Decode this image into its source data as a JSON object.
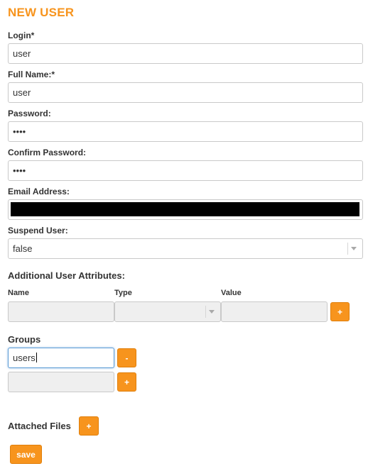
{
  "form": {
    "title": "NEW USER",
    "login": {
      "label": "Login*",
      "value": "user"
    },
    "full_name": {
      "label": "Full Name:*",
      "value": "user"
    },
    "password": {
      "label": "Password:",
      "value": "••••"
    },
    "confirm_password": {
      "label": "Confirm Password:",
      "value": "••••"
    },
    "email": {
      "label": "Email Address:",
      "value": ""
    },
    "suspend": {
      "label": "Suspend User:",
      "value": "false"
    },
    "attributes": {
      "label": "Additional User Attributes:",
      "col_name": "Name",
      "col_type": "Type",
      "col_value": "Value",
      "row": {
        "name": "",
        "type": "",
        "value": ""
      },
      "add_label": "+"
    },
    "groups": {
      "label": "Groups",
      "items": [
        {
          "value": "users",
          "button": "-"
        }
      ],
      "new_value": "",
      "add_label": "+"
    },
    "attached_files": {
      "label": "Attached Files",
      "add_label": "+"
    },
    "save_label": "save"
  },
  "colors": {
    "accent": "#f7941d",
    "field_border": "#c9c9c9",
    "field_disabled": "#efefef",
    "focus": "#5b9bd5"
  }
}
